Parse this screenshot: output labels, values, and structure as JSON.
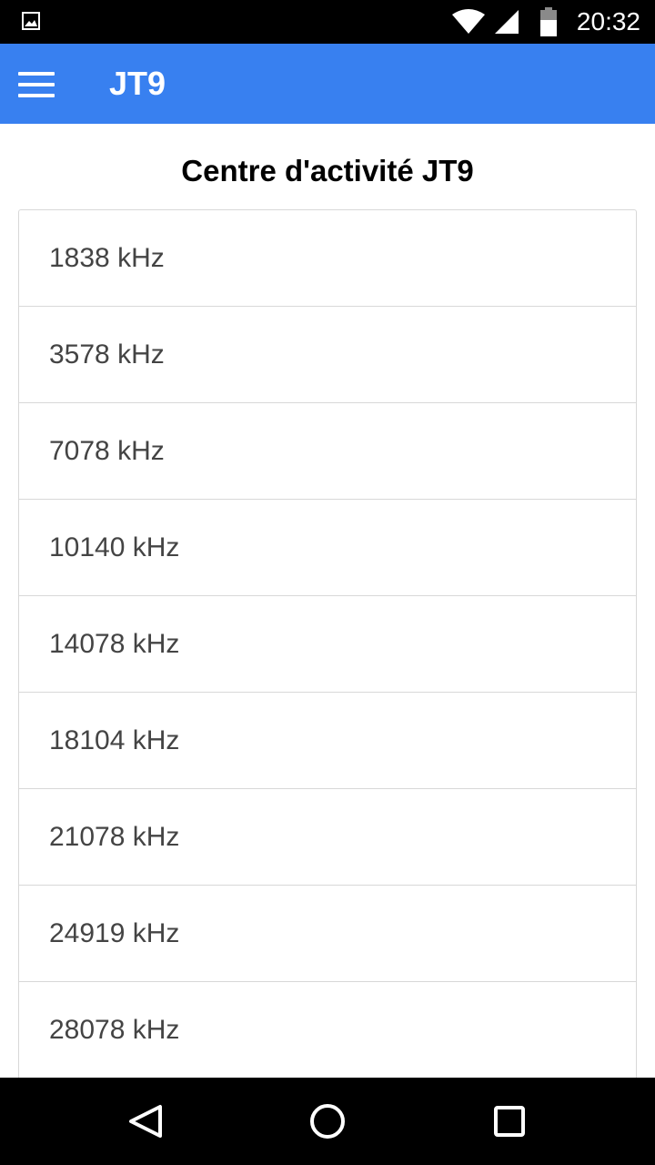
{
  "status_bar": {
    "time": "20:32",
    "icons": [
      "image-notification-icon",
      "wifi-icon",
      "cell-signal-icon",
      "battery-icon"
    ]
  },
  "app_bar": {
    "title": "JT9",
    "color": "#3880f0",
    "menu_icon": "hamburger-menu-icon"
  },
  "main": {
    "heading": "Centre d'activité JT9",
    "frequencies": [
      "1838 kHz",
      "3578 kHz",
      "7078 kHz",
      "10140 kHz",
      "14078 kHz",
      "18104 kHz",
      "21078 kHz",
      "24919 kHz",
      "28078 kHz"
    ]
  },
  "nav_bar": {
    "icons": [
      "back-icon",
      "home-icon",
      "recents-icon"
    ]
  }
}
